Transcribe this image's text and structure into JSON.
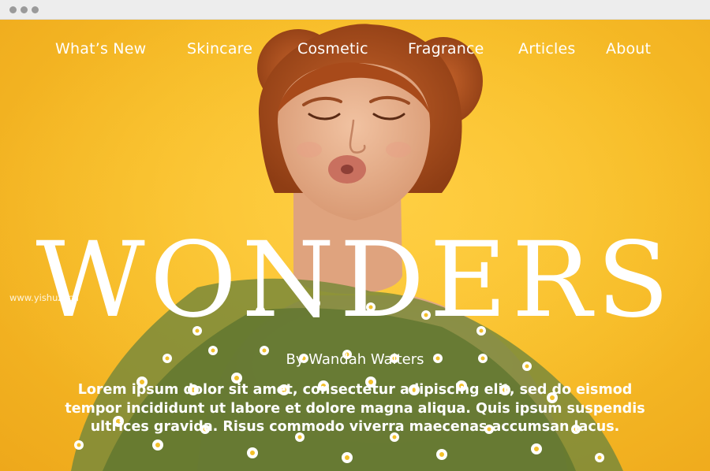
{
  "nav": {
    "items": [
      {
        "label": "What’s New"
      },
      {
        "label": "Skincare"
      },
      {
        "label": "Cosmetic"
      },
      {
        "label": "Fragrance"
      },
      {
        "label": "Articles"
      },
      {
        "label": "About"
      }
    ]
  },
  "hero": {
    "title": "WONDERS",
    "byline": "By Wandah Walters",
    "body": "Lorem ipsum dolor sit amet, consectetur adipiscing elit, sed do eismod tempor incididunt ut labore et dolore magna aliqua. Quis ipsum suspendis ultrices gravida. Risus commodo viverra maecenas accumsan lacus."
  },
  "watermark": "www.yishuzi.cn",
  "colors": {
    "background": "#f2ba2a",
    "text": "#ffffff",
    "hair": "#b5521e",
    "skin": "#eab08c",
    "chrome": "#ededed"
  }
}
